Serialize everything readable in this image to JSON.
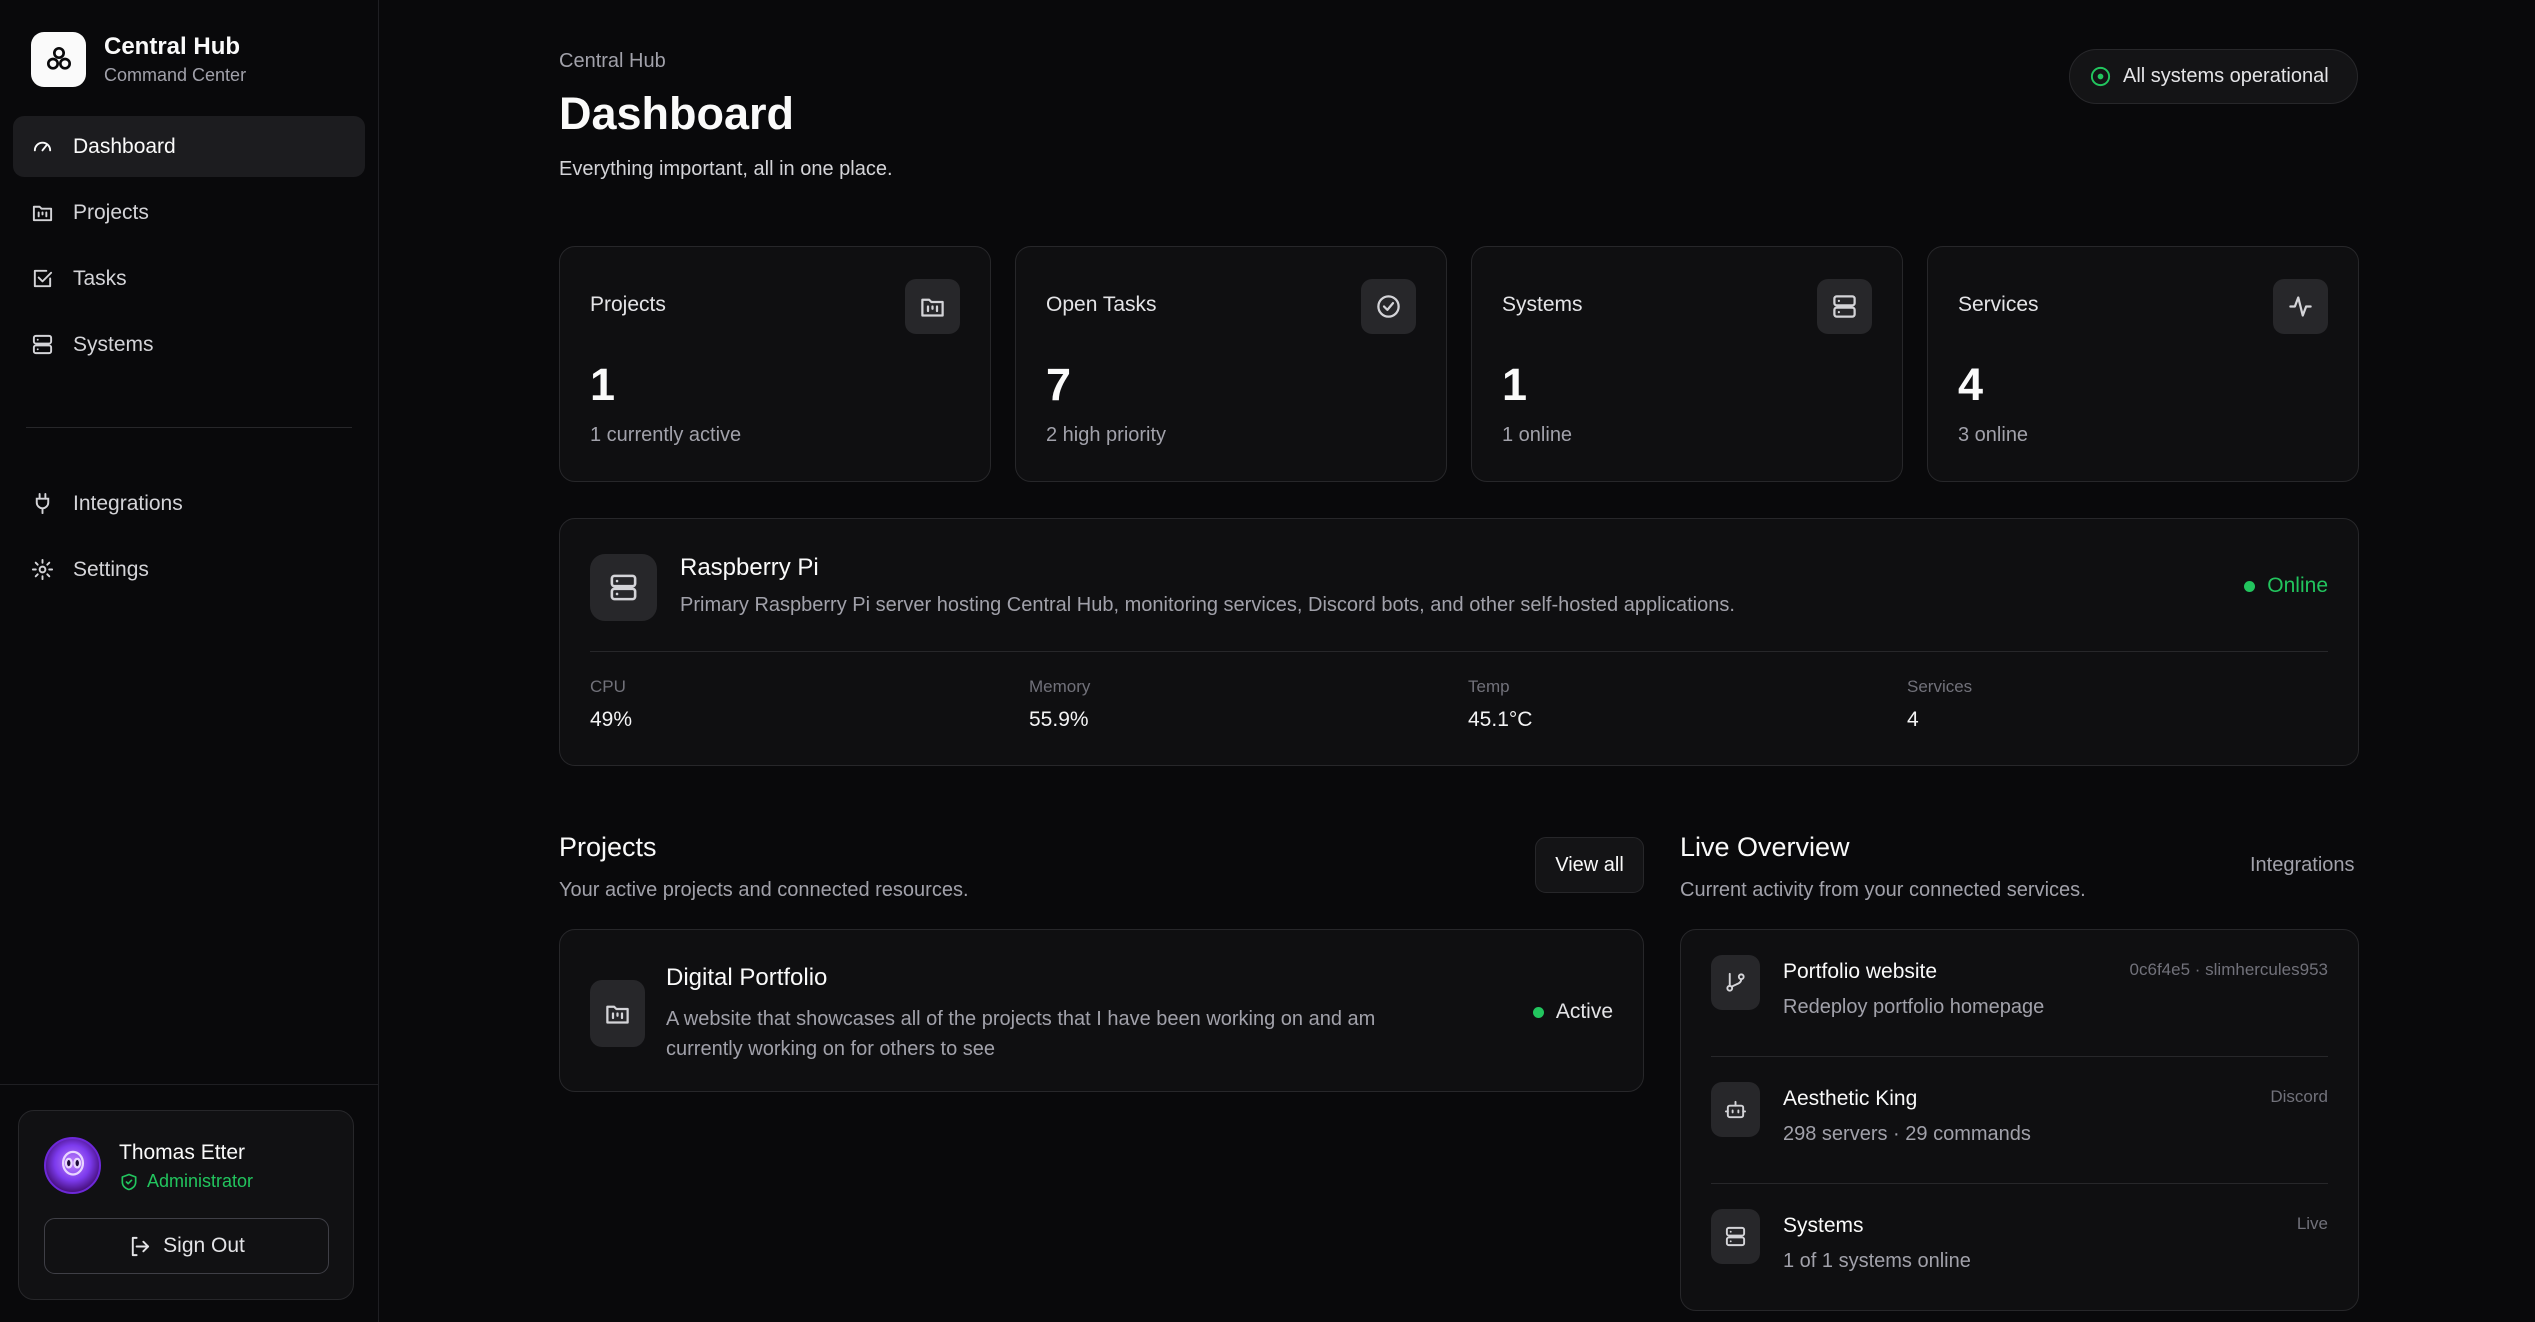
{
  "brand": {
    "title": "Central Hub",
    "subtitle": "Command Center"
  },
  "nav": {
    "items": [
      {
        "label": "Dashboard",
        "icon": "gauge-icon",
        "active": true
      },
      {
        "label": "Projects",
        "icon": "folder-kanban-icon"
      },
      {
        "label": "Tasks",
        "icon": "square-check-icon"
      },
      {
        "label": "Systems",
        "icon": "server-icon"
      }
    ],
    "secondary": [
      {
        "label": "Integrations",
        "icon": "plug-icon"
      },
      {
        "label": "Settings",
        "icon": "gear-icon"
      }
    ]
  },
  "user": {
    "name": "Thomas Etter",
    "role": "Administrator",
    "signout_label": "Sign Out"
  },
  "header": {
    "breadcrumb": "Central Hub",
    "title": "Dashboard",
    "subtitle": "Everything important, all in one place.",
    "status": "All systems operational"
  },
  "stats": [
    {
      "label": "Projects",
      "value": "1",
      "sub": "1 currently active",
      "icon": "folder-kanban-icon"
    },
    {
      "label": "Open Tasks",
      "value": "7",
      "sub": "2 high priority",
      "icon": "circle-check-icon"
    },
    {
      "label": "Systems",
      "value": "1",
      "sub": "1 online",
      "icon": "server-icon"
    },
    {
      "label": "Services",
      "value": "4",
      "sub": "3 online",
      "icon": "activity-icon"
    }
  ],
  "system": {
    "title": "Raspberry Pi",
    "description": "Primary Raspberry Pi server hosting Central Hub, monitoring services, Discord bots, and other self-hosted applications.",
    "status": "Online",
    "metrics": [
      {
        "label": "CPU",
        "value": "49%"
      },
      {
        "label": "Memory",
        "value": "55.9%"
      },
      {
        "label": "Temp",
        "value": "45.1°C"
      },
      {
        "label": "Services",
        "value": "4"
      }
    ]
  },
  "projects": {
    "title": "Projects",
    "subtitle": "Your active projects and connected resources.",
    "view_all": "View all",
    "items": [
      {
        "title": "Digital Portfolio",
        "description": "A website that showcases all of the projects that I have been working on and am currently working on for others to see",
        "status": "Active"
      }
    ]
  },
  "live": {
    "title": "Live Overview",
    "subtitle": "Current activity from your connected services.",
    "link": "Integrations",
    "items": [
      {
        "title": "Portfolio website",
        "description": "Redeploy portfolio homepage",
        "meta": "0c6f4e5 · slimhercules953",
        "icon": "git-branch-icon"
      },
      {
        "title": "Aesthetic King",
        "description": "298 servers · 29 commands",
        "meta": "Discord",
        "icon": "bot-icon"
      },
      {
        "title": "Systems",
        "description": "1 of 1 systems online",
        "meta": "Live",
        "icon": "server-icon"
      }
    ]
  },
  "colors": {
    "accent_green": "#22c55e",
    "background": "#09090b",
    "card": "#0f0f11",
    "border": "#27272a"
  }
}
